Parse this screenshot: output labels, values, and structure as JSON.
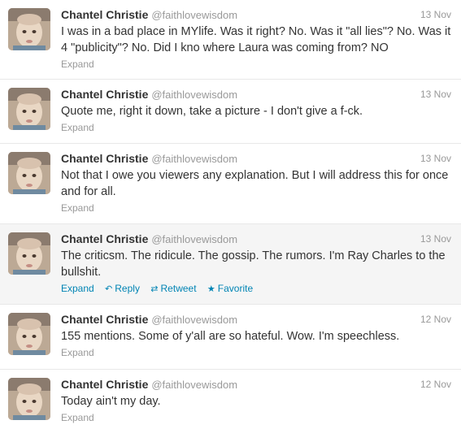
{
  "colors": {
    "link": "#0084b4",
    "muted": "#999999",
    "text": "#333333",
    "hover_bg": "#f5f5f5"
  },
  "tweets": [
    {
      "fullname": "Chantel Christie",
      "username": "@faithlovewisdom",
      "time": "13 Nov",
      "text": "I was in a bad place in MYlife. Was it right? No. Was it \"all lies\"? No. Was it 4 \"publicity\"? No. Did I kno where Laura was coming from? NO",
      "expand": "Expand"
    },
    {
      "fullname": "Chantel Christie",
      "username": "@faithlovewisdom",
      "time": "13 Nov",
      "text": "Quote me, right it down, take a picture - I don't give a f-ck.",
      "expand": "Expand"
    },
    {
      "fullname": "Chantel Christie",
      "username": "@faithlovewisdom",
      "time": "13 Nov",
      "text": "Not that I owe you viewers any explanation. But I will address this for once and for all.",
      "expand": "Expand"
    },
    {
      "fullname": "Chantel Christie",
      "username": "@faithlovewisdom",
      "time": "13 Nov",
      "text": "The criticsm. The ridicule. The gossip. The rumors. I'm Ray Charles to the bullshit.",
      "expand": "Expand",
      "reply": "Reply",
      "retweet": "Retweet",
      "favorite": "Favorite",
      "reply_icon": "reply-icon",
      "retweet_icon": "retweet-icon",
      "favorite_icon": "star-icon"
    },
    {
      "fullname": "Chantel Christie",
      "username": "@faithlovewisdom",
      "time": "12 Nov",
      "text": "155 mentions. Some of y'all are so hateful. Wow. I'm speechless.",
      "expand": "Expand"
    },
    {
      "fullname": "Chantel Christie",
      "username": "@faithlovewisdom",
      "time": "12 Nov",
      "text": "Today ain't my day.",
      "expand": "Expand"
    }
  ]
}
